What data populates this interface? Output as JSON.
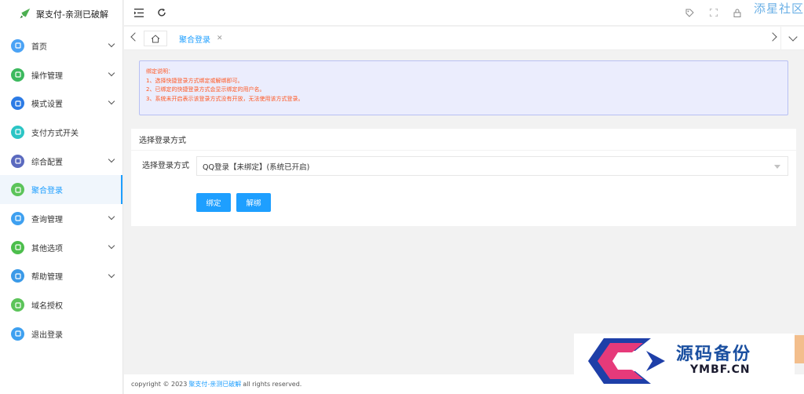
{
  "brand": {
    "title": "聚支付-亲测已破解"
  },
  "sidebar": {
    "items": [
      {
        "label": "首页",
        "icon": "home-icon",
        "color": "#4ba3f5",
        "arrow": true
      },
      {
        "label": "操作管理",
        "icon": "sliders-icon",
        "color": "#3cb95e",
        "arrow": true
      },
      {
        "label": "模式设置",
        "icon": "grid-icon",
        "color": "#2c7be5",
        "arrow": true
      },
      {
        "label": "支付方式开关",
        "icon": "toggle-icon",
        "color": "#2bc5c5",
        "arrow": false
      },
      {
        "label": "综合配置",
        "icon": "book-icon",
        "color": "#5b6abf",
        "arrow": true
      },
      {
        "label": "聚合登录",
        "icon": "login-icon",
        "color": "#5cc45a",
        "arrow": false,
        "active": true
      },
      {
        "label": "查询管理",
        "icon": "search-icon",
        "color": "#3ea0f0",
        "arrow": true
      },
      {
        "label": "其他选项",
        "icon": "list-icon",
        "color": "#4cbe4c",
        "arrow": true
      },
      {
        "label": "帮助管理",
        "icon": "edit-icon",
        "color": "#3b9ae8",
        "arrow": true
      },
      {
        "label": "域名授权",
        "icon": "shield-icon",
        "color": "#5cc45a",
        "arrow": false
      },
      {
        "label": "退出登录",
        "icon": "power-icon",
        "color": "#3ea0f0",
        "arrow": false
      }
    ]
  },
  "header": {
    "corner_text": "添星社区"
  },
  "tabs": {
    "active_label": "聚合登录"
  },
  "notice": {
    "lines": [
      "绑定说明：",
      "1、选择快捷登录方式绑定或解绑即可。",
      "2、已绑定的快捷登录方式会显示绑定的用户名。",
      "3、系统未开启表示该登录方式没有开放，无法使用该方式登录。"
    ]
  },
  "card": {
    "title": "选择登录方式",
    "field_label": "选择登录方式",
    "select_value": "QQ登录【未绑定】(系统已开启)",
    "bind_label": "绑定",
    "unbind_label": "解绑"
  },
  "footer": {
    "prefix": "copyright © 2023",
    "link": "聚支付-亲测已破解",
    "suffix": "all rights reserved."
  },
  "watermark": {
    "title": "源码备份",
    "sub": "YMBF.CN",
    "logo_char": "码"
  }
}
